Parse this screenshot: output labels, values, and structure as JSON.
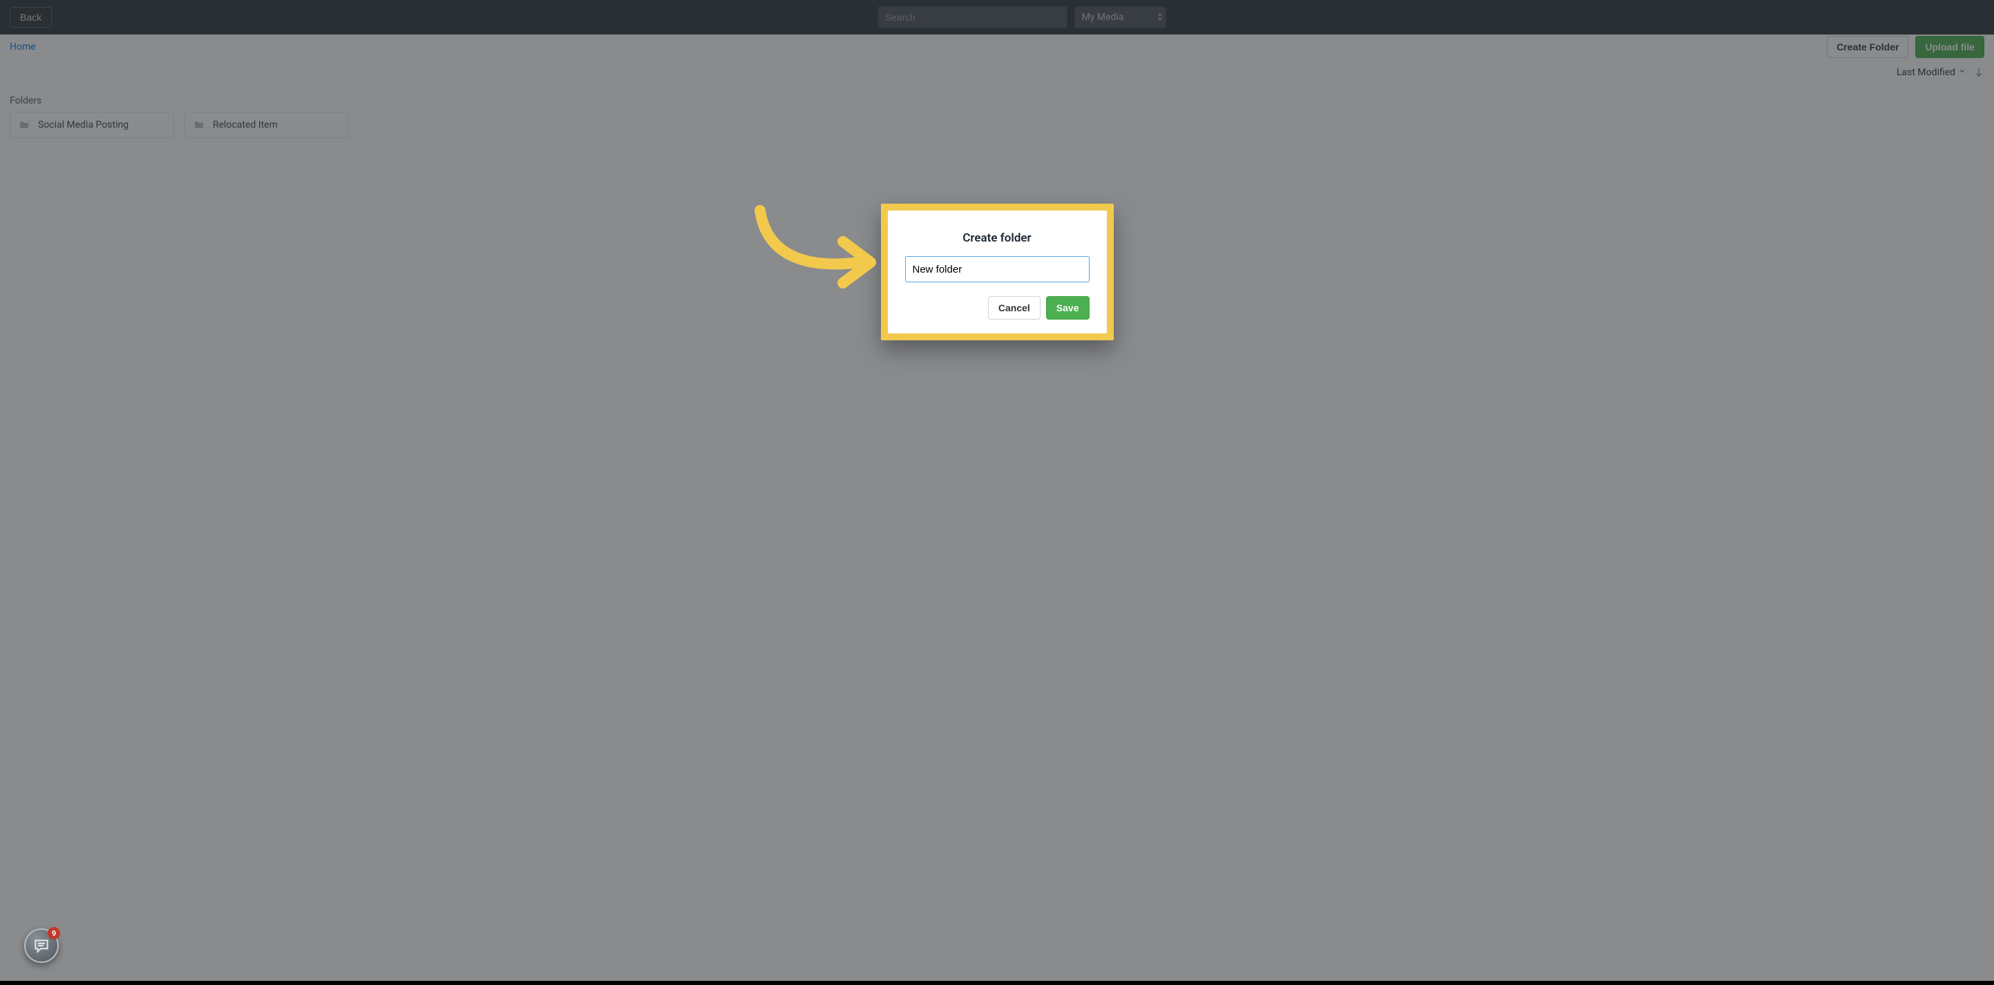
{
  "topbar": {
    "back_label": "Back",
    "search_placeholder": "Search",
    "media_select_label": "My Media"
  },
  "subheader": {
    "breadcrumb_home": "Home",
    "create_folder_label": "Create Folder",
    "upload_file_label": "Upload file"
  },
  "sortbar": {
    "sort_label": "Last Modified"
  },
  "main": {
    "folders_heading": "Folders",
    "folders": [
      {
        "name": "Social Media Posting"
      },
      {
        "name": "Relocated Item"
      }
    ]
  },
  "modal": {
    "title": "Create folder",
    "input_value": "New folder",
    "cancel_label": "Cancel",
    "save_label": "Save"
  },
  "chat": {
    "badge_count": "9"
  }
}
